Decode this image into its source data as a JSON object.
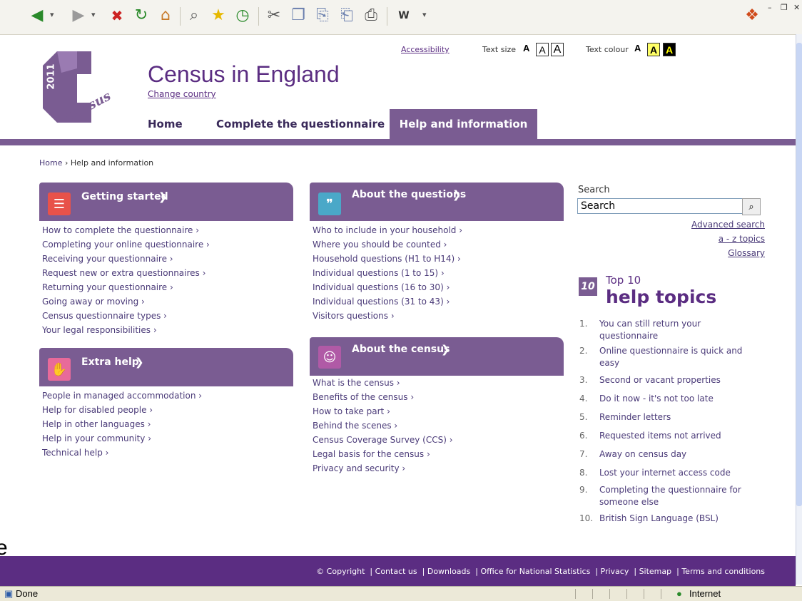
{
  "browser": {
    "status": "Done",
    "zone": "Internet"
  },
  "header": {
    "logo_text": "Census",
    "logo_year": "2011",
    "title": "Census in England",
    "change_country": "Change country",
    "accessibility": "Accessibility",
    "text_size_label": "Text size",
    "text_size_options": [
      "A",
      "A",
      "A"
    ],
    "text_colour_label": "Text colour",
    "text_colour_options": [
      "A",
      "A",
      "A"
    ]
  },
  "nav": {
    "items": [
      "Home",
      "Complete the questionnaire",
      "Help and information"
    ],
    "active": "Help and information"
  },
  "breadcrumb": {
    "home": "Home",
    "current": "Help and information"
  },
  "sections": {
    "getting_started": {
      "title": "Getting started",
      "links": [
        "How to complete the questionnaire",
        "Completing your online questionnaire",
        "Receiving your questionnaire",
        "Request new or extra questionnaires",
        "Returning your questionnaire",
        "Going away or moving",
        "Census questionnaire types",
        "Your legal responsibilities"
      ]
    },
    "extra_help": {
      "title": "Extra help",
      "links": [
        "People in managed accommodation",
        "Help for disabled people",
        "Help in other languages",
        "Help in your community",
        "Technical help"
      ]
    },
    "about_questions": {
      "title": "About the questions",
      "links": [
        "Who to include in your household",
        "Where you should be counted",
        "Household questions (H1 to H14)",
        "Individual questions (1 to 15)",
        "Individual questions (16 to 30)",
        "Individual questions (31 to 43)",
        "Visitors questions"
      ]
    },
    "about_census": {
      "title": "About the census",
      "links": [
        "What is the census",
        "Benefits of the census",
        "How to take part",
        "Behind the scenes",
        "Census Coverage Survey (CCS)",
        "Legal basis for the census",
        "Privacy and security"
      ]
    }
  },
  "search": {
    "label": "Search",
    "value": "Search",
    "advanced": "Advanced search",
    "az": "a - z topics",
    "glossary": "Glossary"
  },
  "top10": {
    "badge": "10",
    "small": "Top 10",
    "big": "help topics",
    "items": [
      "You can still return your questionnaire",
      "Online questionnaire is quick and easy",
      "Second or vacant properties",
      "Do it now - it's not too late",
      "Reminder letters",
      "Requested items not arrived",
      "Away on census day",
      "Lost your internet access code",
      "Completing the questionnaire for someone else",
      "British Sign Language (BSL)"
    ]
  },
  "footer": {
    "copyright": "© Copyright",
    "links": [
      "Contact us",
      "Downloads",
      "Office for National Statistics",
      "Privacy",
      "Sitemap",
      "Terms and conditions"
    ]
  },
  "stray_text": "e",
  "colors": {
    "brand_purple": "#7a5c92",
    "dark_purple": "#5b2d82",
    "link": "#4a3a78"
  }
}
